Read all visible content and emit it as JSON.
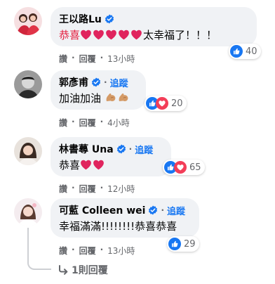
{
  "comments": [
    {
      "name": "王以路Lu",
      "text_accent": "恭喜",
      "text_suffix": "太幸福了！！！",
      "heart_count": 5,
      "reaction_count": "40",
      "actions": {
        "like": "讚",
        "reply": "回覆",
        "time": "13小時"
      },
      "reactions": [
        "like-icon"
      ]
    },
    {
      "name": "郭彥甫",
      "follow": "追蹤",
      "text": "加油加油",
      "reaction_count": "20",
      "actions": {
        "like": "讚",
        "reply": "回覆",
        "time": "4小時"
      },
      "reactions": [
        "like-icon",
        "love-icon"
      ]
    },
    {
      "name": "林書蕁 Una",
      "follow": "追蹤",
      "text": "恭喜",
      "heart_count": 2,
      "reaction_count": "65",
      "actions": {
        "like": "讚",
        "reply": "回覆",
        "time": "12小時"
      },
      "reactions": [
        "like-icon",
        "love-icon"
      ]
    },
    {
      "name": "可藍 Colleen wei",
      "follow": "追蹤",
      "text": "幸福滿滿!!!!!!!!恭喜恭喜",
      "reaction_count": "29",
      "actions": {
        "like": "讚",
        "reply": "回覆",
        "time": "13小時"
      },
      "reactions": [
        "like-icon"
      ]
    }
  ],
  "replies_link": "1則回覆",
  "separator": "·",
  "colors": {
    "bubble": "#f0f2f5",
    "like_blue": "#1877f2",
    "love_red": "#f33e58",
    "accent_red": "#e41e3f",
    "meta_gray": "#65676b"
  }
}
